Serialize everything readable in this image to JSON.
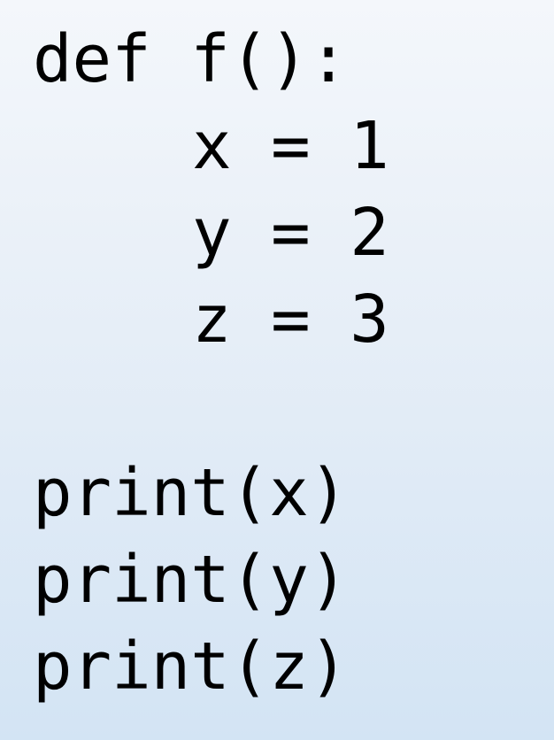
{
  "code": {
    "lines": [
      "def f():",
      "x = 1",
      "y = 2",
      "z = 3",
      "",
      "print(x)",
      "print(y)",
      "print(z)"
    ]
  }
}
